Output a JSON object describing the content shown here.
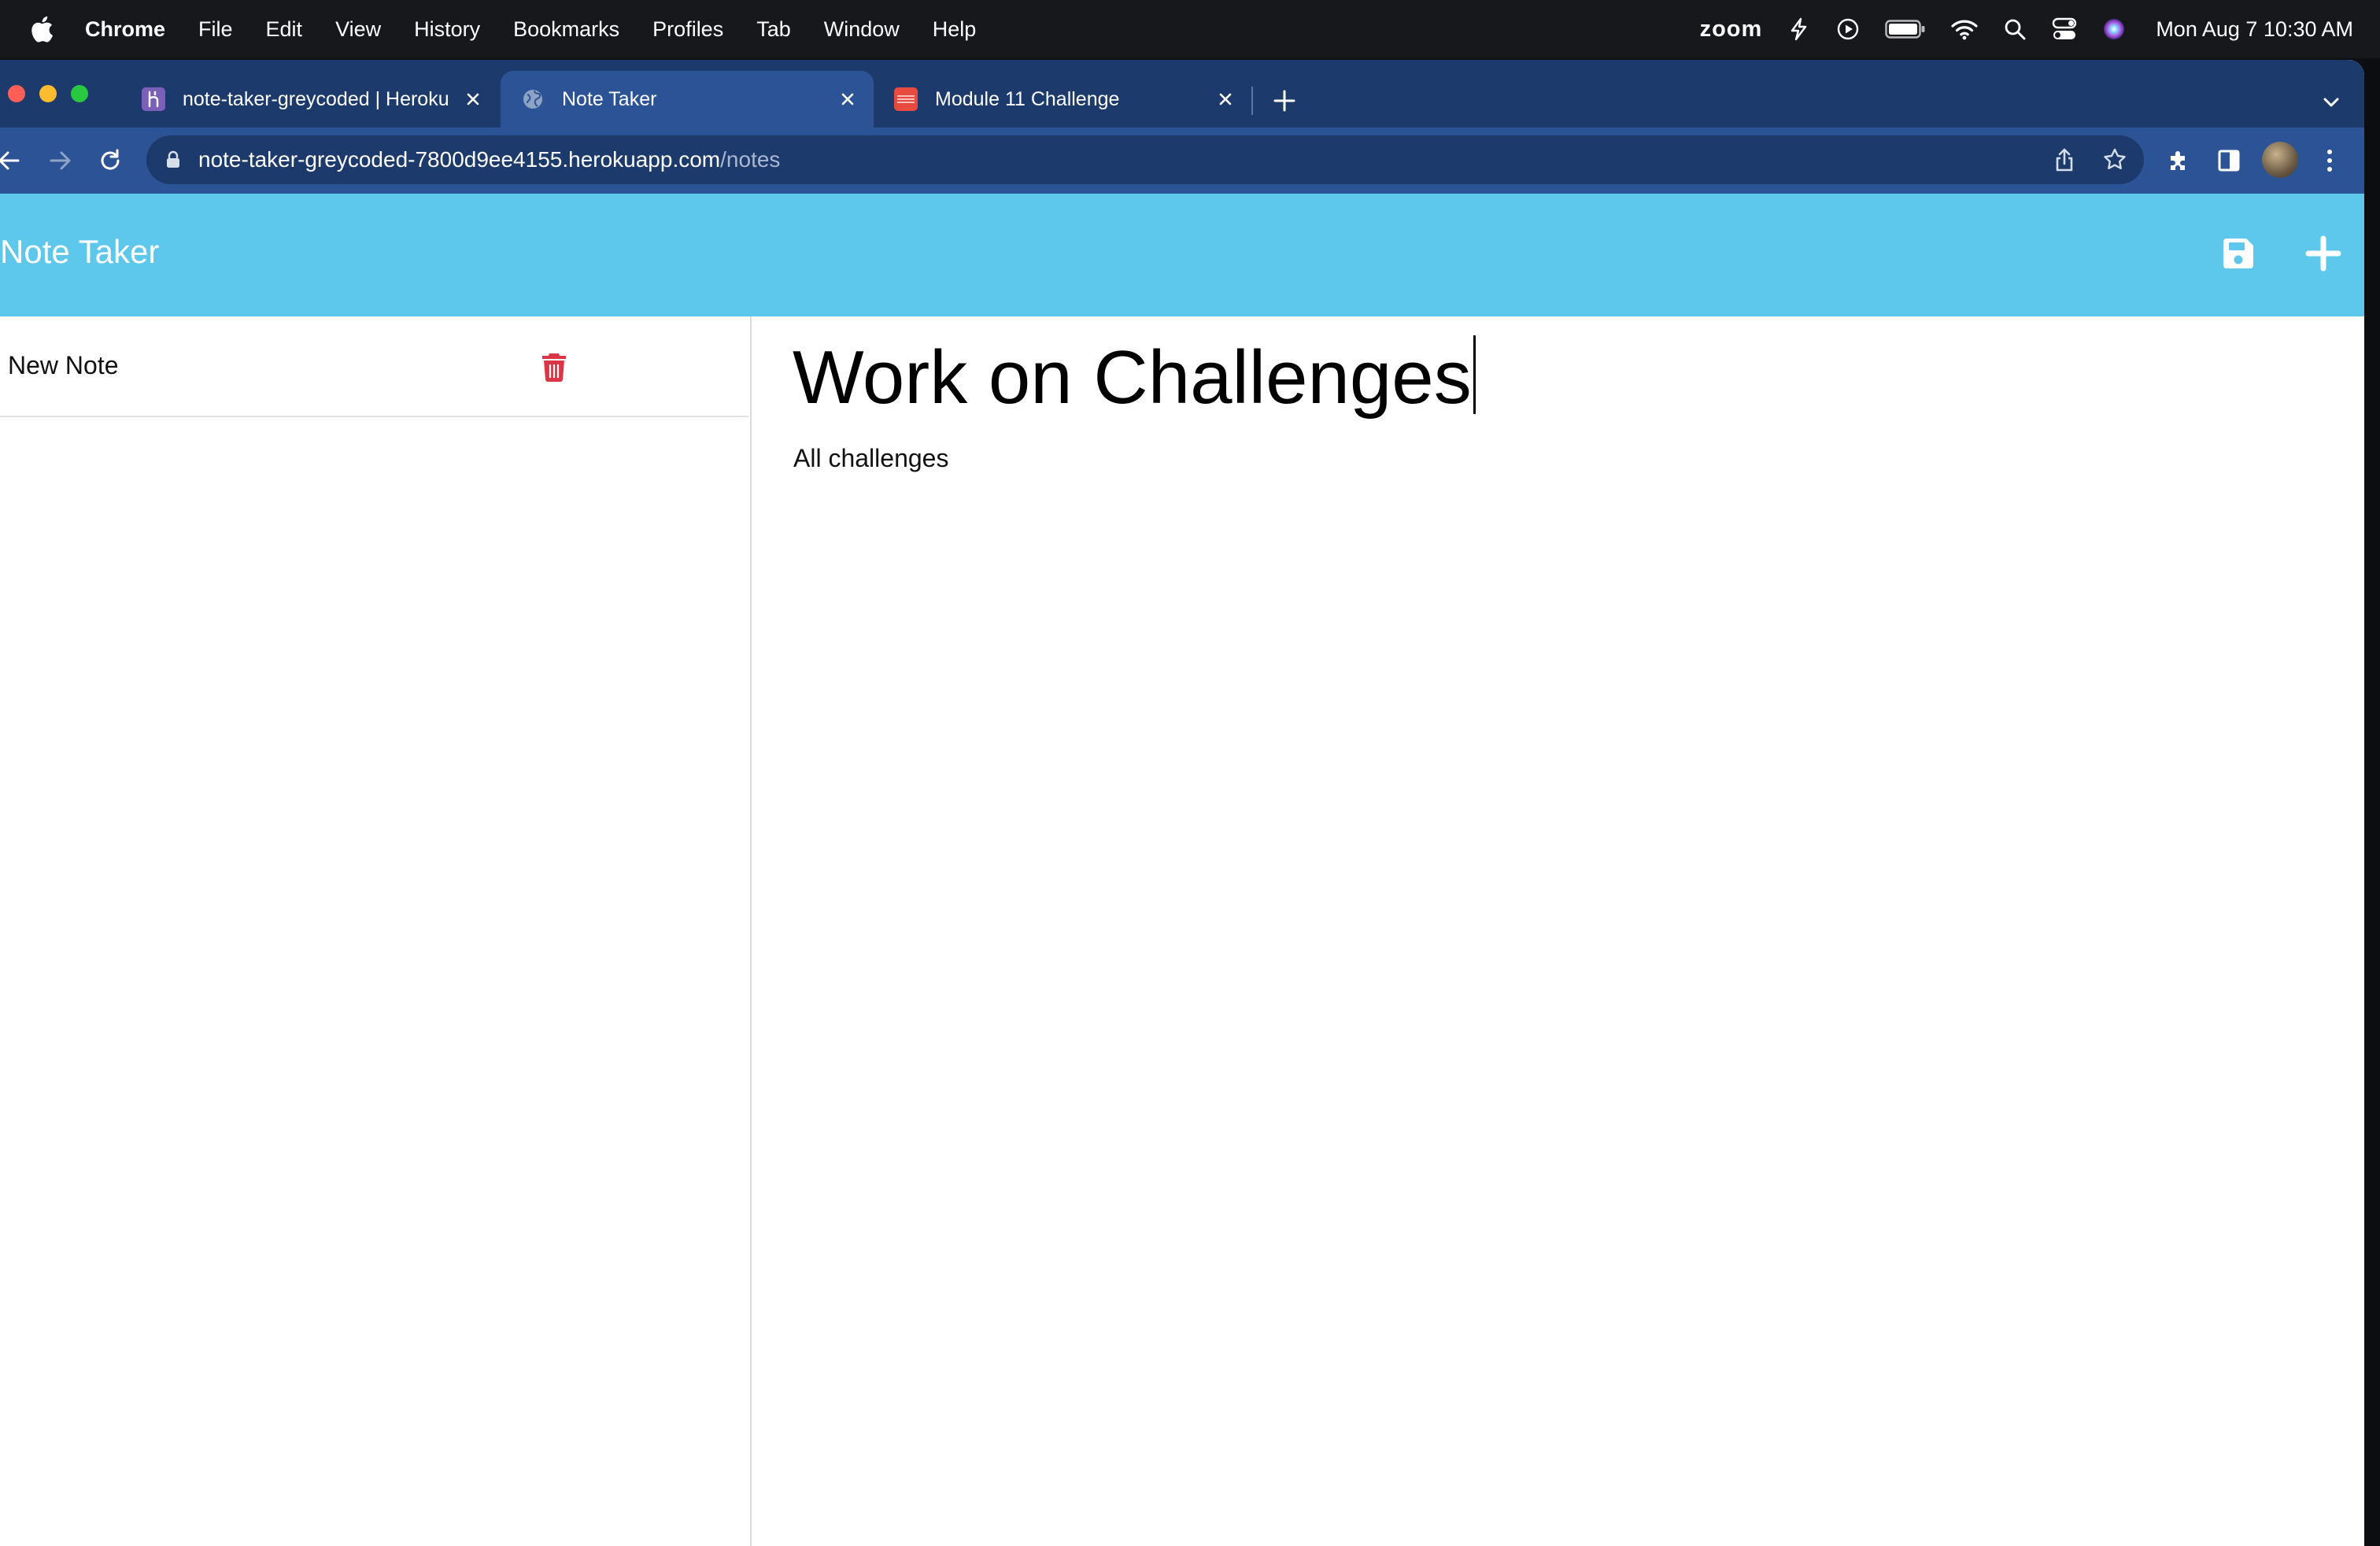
{
  "menubar": {
    "app_name": "Chrome",
    "items": [
      "File",
      "Edit",
      "View",
      "History",
      "Bookmarks",
      "Profiles",
      "Tab",
      "Window",
      "Help"
    ],
    "zoom_label": "zoom",
    "clock": "Mon Aug 7  10:30 AM"
  },
  "tabs": [
    {
      "title": "note-taker-greycoded | Heroku",
      "favicon": "heroku-icon",
      "active": false
    },
    {
      "title": "Note Taker",
      "favicon": "globe-icon",
      "active": true
    },
    {
      "title": "Module 11 Challenge",
      "favicon": "bootcamp-icon",
      "active": false
    }
  ],
  "address_bar": {
    "host": "note-taker-greycoded-7800d9ee4155.herokuapp.com",
    "path": "/notes"
  },
  "app": {
    "brand": "Note Taker",
    "accent_color": "#5dc7ec",
    "delete_color": "#dc3545"
  },
  "notes_list": [
    {
      "title": "New Note"
    }
  ],
  "editor": {
    "title": "Work on Challenges",
    "body": "All challenges"
  }
}
